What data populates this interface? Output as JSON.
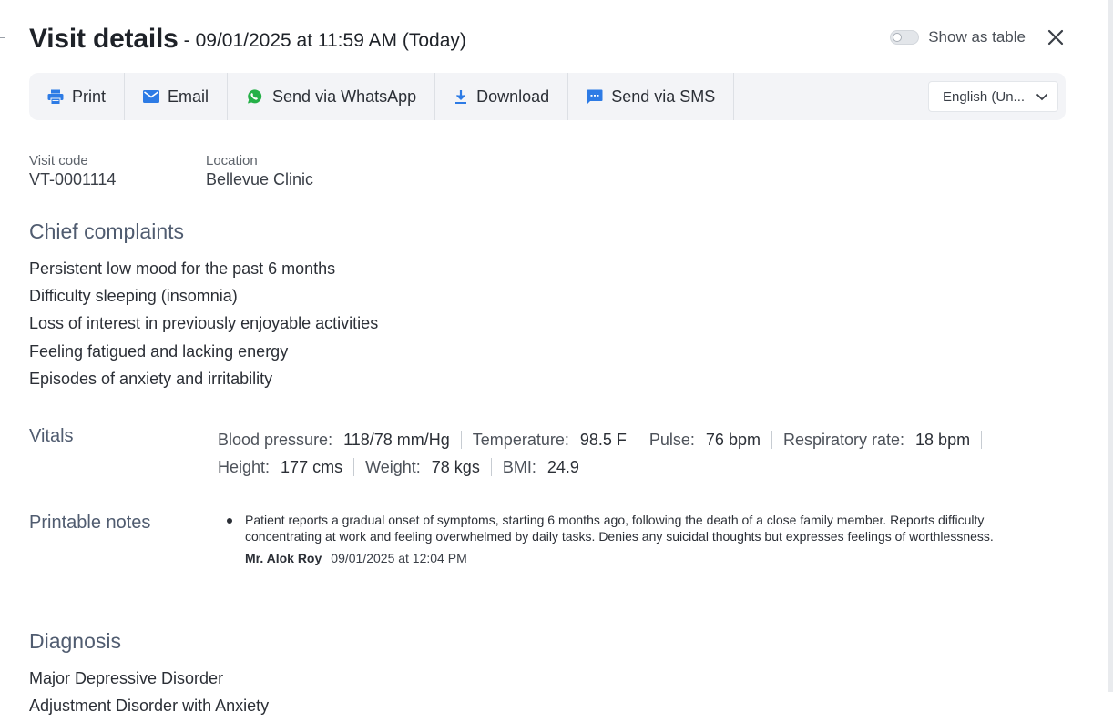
{
  "header": {
    "title": "Visit details",
    "separator": "-",
    "date": "09/01/2025 at 11:59 AM (Today)",
    "toggle_label": "Show as table",
    "toggle_on": false
  },
  "toolbar": {
    "print": "Print",
    "email": "Email",
    "whatsapp": "Send via WhatsApp",
    "download": "Download",
    "sms": "Send via SMS",
    "language": "English (Un..."
  },
  "meta": {
    "visit_code_label": "Visit code",
    "visit_code": "VT-0001114",
    "location_label": "Location",
    "location": "Bellevue Clinic"
  },
  "complaints": {
    "title": "Chief complaints",
    "items": [
      "Persistent low mood for the past 6 months",
      "Difficulty sleeping (insomnia)",
      "Loss of interest in previously enjoyable activities",
      "Feeling fatigued and lacking energy",
      "Episodes of anxiety and irritability"
    ]
  },
  "vitals": {
    "title": "Vitals",
    "bp_label": "Blood pressure:",
    "bp": "118/78 mm/Hg",
    "temp_label": "Temperature:",
    "temp": "98.5 F",
    "pulse_label": "Pulse:",
    "pulse": "76 bpm",
    "resp_label": "Respiratory rate:",
    "resp": "18 bpm",
    "height_label": "Height:",
    "height": "177 cms",
    "weight_label": "Weight:",
    "weight": "78 kgs",
    "bmi_label": "BMI:",
    "bmi": "24.9"
  },
  "notes": {
    "title": "Printable notes",
    "text": "Patient reports a gradual onset of symptoms, starting 6 months ago, following the death of a close family member. Reports difficulty concentrating at work and feeling overwhelmed by daily tasks. Denies any suicidal thoughts but expresses feelings of worthlessness.",
    "author": "Mr. Alok Roy",
    "time": "09/01/2025 at 12:04 PM"
  },
  "diagnosis": {
    "title": "Diagnosis",
    "items": [
      "Major Depressive Disorder",
      "Adjustment Disorder with Anxiety"
    ]
  },
  "colors": {
    "accent": "#2d7be5",
    "whatsapp": "#25b048",
    "section_heading": "#505c70",
    "toolbar_bg": "#f3f4f7"
  },
  "icons": {
    "print": "printer-icon",
    "email": "mail-icon",
    "whatsapp": "whatsapp-icon",
    "download": "download-icon",
    "sms": "message-icon",
    "close": "close-icon",
    "dropdown": "chevron-down-icon"
  }
}
